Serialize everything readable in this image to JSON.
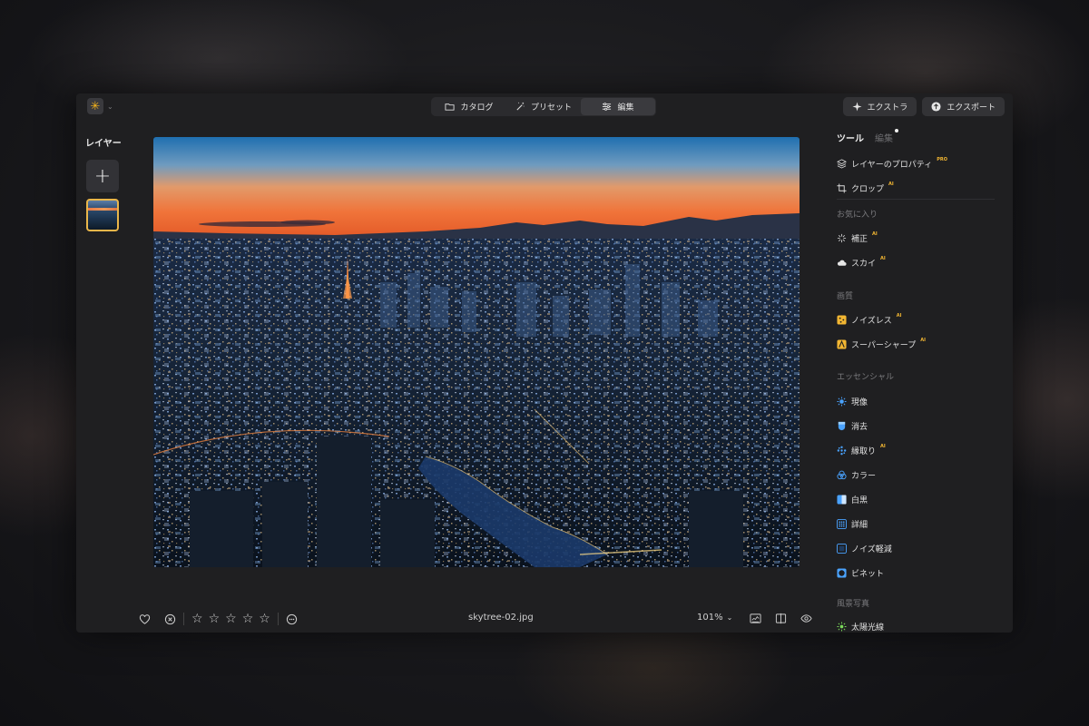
{
  "topbar": {
    "logo_icon": "sun-logo-icon",
    "tabs": [
      {
        "label": "カタログ",
        "icon": "folder-icon",
        "active": false
      },
      {
        "label": "プリセット",
        "icon": "magic-wand-icon",
        "active": false
      },
      {
        "label": "編集",
        "icon": "sliders-icon",
        "active": true
      }
    ],
    "extras_label": "エクストラ",
    "export_label": "エクスポート"
  },
  "layers": {
    "title": "レイヤー"
  },
  "bottombar": {
    "filename": "skytree-02.jpg",
    "zoom": "101%",
    "rating": 0,
    "max_rating": 5
  },
  "panel": {
    "tab_tools": "ツール",
    "tab_edit": "編集",
    "top_items": [
      {
        "label": "レイヤーのプロパティ",
        "badge": "PRO",
        "icon": "layers-icon"
      },
      {
        "label": "クロップ",
        "badge": "AI",
        "icon": "crop-icon"
      }
    ],
    "sections": [
      {
        "title": "お気に入り",
        "items": [
          {
            "label": "補正",
            "badge": "AI",
            "icon": "sparkle-icon"
          },
          {
            "label": "スカイ",
            "badge": "AI",
            "icon": "cloud-icon"
          }
        ]
      },
      {
        "title": "画質",
        "items": [
          {
            "label": "ノイズレス",
            "badge": "AI",
            "icon": "noiseless-icon"
          },
          {
            "label": "スーパーシャープ",
            "badge": "AI",
            "icon": "supersharp-icon"
          }
        ]
      },
      {
        "title": "エッセンシャル",
        "items": [
          {
            "label": "現像",
            "badge": "",
            "icon": "develop-icon"
          },
          {
            "label": "消去",
            "badge": "",
            "icon": "erase-icon"
          },
          {
            "label": "縁取り",
            "badge": "AI",
            "icon": "structure-icon"
          },
          {
            "label": "カラー",
            "badge": "",
            "icon": "color-icon"
          },
          {
            "label": "白黒",
            "badge": "",
            "icon": "bw-icon"
          },
          {
            "label": "詳細",
            "badge": "",
            "icon": "details-icon"
          },
          {
            "label": "ノイズ軽減",
            "badge": "",
            "icon": "denoise-icon"
          },
          {
            "label": "ビネット",
            "badge": "",
            "icon": "vignette-icon"
          }
        ]
      },
      {
        "title": "風景写真",
        "items": [
          {
            "label": "太陽光線",
            "badge": "",
            "icon": "sunrays-icon"
          }
        ]
      }
    ]
  },
  "colors": {
    "accent": "#f2b632",
    "window_bg": "#1f1f21",
    "panel_icon_blue": "#4aa3ff"
  }
}
